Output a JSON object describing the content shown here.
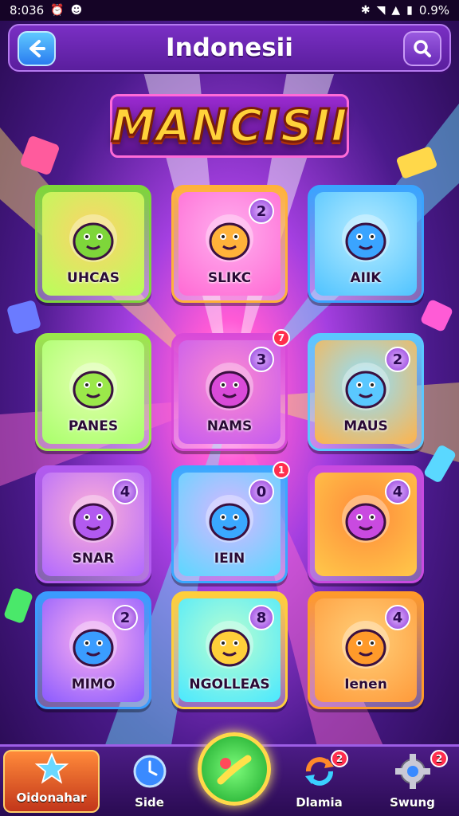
{
  "status_bar": {
    "time": "8:036",
    "battery": "0.9%"
  },
  "header": {
    "title": "Indonesii"
  },
  "logo_text": "MANCISII",
  "cards": [
    {
      "label": "UHCAS",
      "badge": "",
      "colors": [
        "#b8ff5a",
        "#ffd26a"
      ],
      "frame": "#7ed63a"
    },
    {
      "label": "SLIKC",
      "badge": "2",
      "colors": [
        "#ff6ad4",
        "#ffb0ef"
      ],
      "frame": "#ffb23a"
    },
    {
      "label": "AIIK",
      "badge": "",
      "colors": [
        "#4fc3ff",
        "#b7ecff"
      ],
      "frame": "#3aa4ff"
    },
    {
      "label": "PANES",
      "badge": "",
      "colors": [
        "#a8ff6a",
        "#e4ffb0"
      ],
      "frame": "#9be84a"
    },
    {
      "label": "NAMS",
      "badge": "3",
      "colors": [
        "#c35af0",
        "#ff8ad0"
      ],
      "frame": "#d94ad8"
    },
    {
      "label": "MAUS",
      "badge": "2",
      "colors": [
        "#ffb34a",
        "#8fe0ff"
      ],
      "frame": "#5ac8ff"
    },
    {
      "label": "SNAR",
      "badge": "4",
      "colors": [
        "#b068ff",
        "#ffb0d6"
      ],
      "frame": "#b25af0"
    },
    {
      "label": "IEIN",
      "badge": "0",
      "colors": [
        "#5ad8ff",
        "#d9b6ff"
      ],
      "frame": "#3aa8ff"
    },
    {
      "label": "",
      "badge": "4",
      "colors": [
        "#ffc94a",
        "#ff8a3a"
      ],
      "frame": "#c94ae0"
    },
    {
      "label": "MIMO",
      "badge": "2",
      "colors": [
        "#8a5aff",
        "#ffb0ef"
      ],
      "frame": "#3a9cff"
    },
    {
      "label": "NGOLLEAS",
      "badge": "8",
      "colors": [
        "#4ae8ff",
        "#baffd0"
      ],
      "frame": "#ffcf3a"
    },
    {
      "label": "Ienen",
      "badge": "4",
      "colors": [
        "#ff9a3a",
        "#ffd07a"
      ],
      "frame": "#ff9a2a"
    }
  ],
  "notifications": {
    "card5": "7",
    "card8": "1",
    "nav_clans": "2",
    "nav_settings": "2"
  },
  "nav": {
    "items": [
      {
        "label": "Oidonahar"
      },
      {
        "label": "Side"
      },
      {
        "label": ""
      },
      {
        "label": "Dlamia"
      },
      {
        "label": "Swung"
      }
    ]
  },
  "icons": {
    "back": "arrow-left-icon",
    "search": "search-icon",
    "home": "star-icon",
    "side": "clock-icon",
    "center": "play-icon",
    "clans": "refresh-icon",
    "settings": "gear-icon"
  }
}
